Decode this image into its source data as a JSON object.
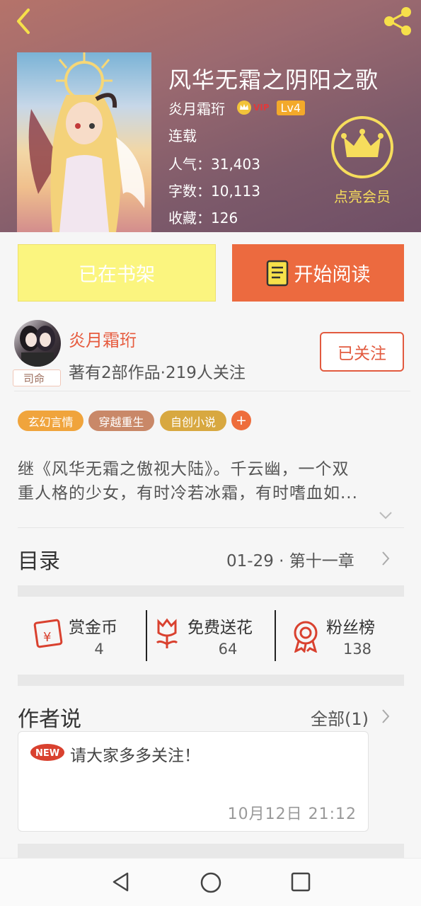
{
  "header": {
    "title": "风华无霜之阴阳之歌",
    "author": "炎月霜珩",
    "vip_label": "VIP",
    "level": "Lv4",
    "status": "连载",
    "popularity": "人气：31,403",
    "word_count": "字数：10,113",
    "favorites": "收藏：126",
    "member_label": "点亮会员"
  },
  "actions": {
    "shelf_label": "已在书架",
    "read_label": "开始阅读"
  },
  "author": {
    "name": "炎月霜珩",
    "rank": "司命",
    "meta": "著有2部作品·219人关注",
    "follow_label": "已关注"
  },
  "tags": [
    {
      "label": "玄幻言情",
      "color": "#f0a43c"
    },
    {
      "label": "穿越重生",
      "color": "#c98868"
    },
    {
      "label": "自创小说",
      "color": "#d8a840"
    }
  ],
  "tag_add": "+",
  "synopsis": {
    "line1": "继《风华无霜之傲视大陆》。千云幽，一个双",
    "line2": "重人格的少女，有时冷若冰霜，有时嗜血如..."
  },
  "catalog": {
    "title": "目录",
    "latest": "01-29 · 第十一章"
  },
  "perks": [
    {
      "label": "赏金币",
      "count": "4"
    },
    {
      "label": "免费送花",
      "count": "64"
    },
    {
      "label": "粉丝榜",
      "count": "138"
    }
  ],
  "author_notes": {
    "title": "作者说",
    "all_link": "全部(1)",
    "new_badge": "NEW",
    "text": "请大家多多关注！",
    "time": "10月12日  21:12"
  },
  "colors": {
    "accent": "#ec6a3f",
    "shelf_bg": "#fbf57f",
    "gold": "#f6dd5c"
  }
}
